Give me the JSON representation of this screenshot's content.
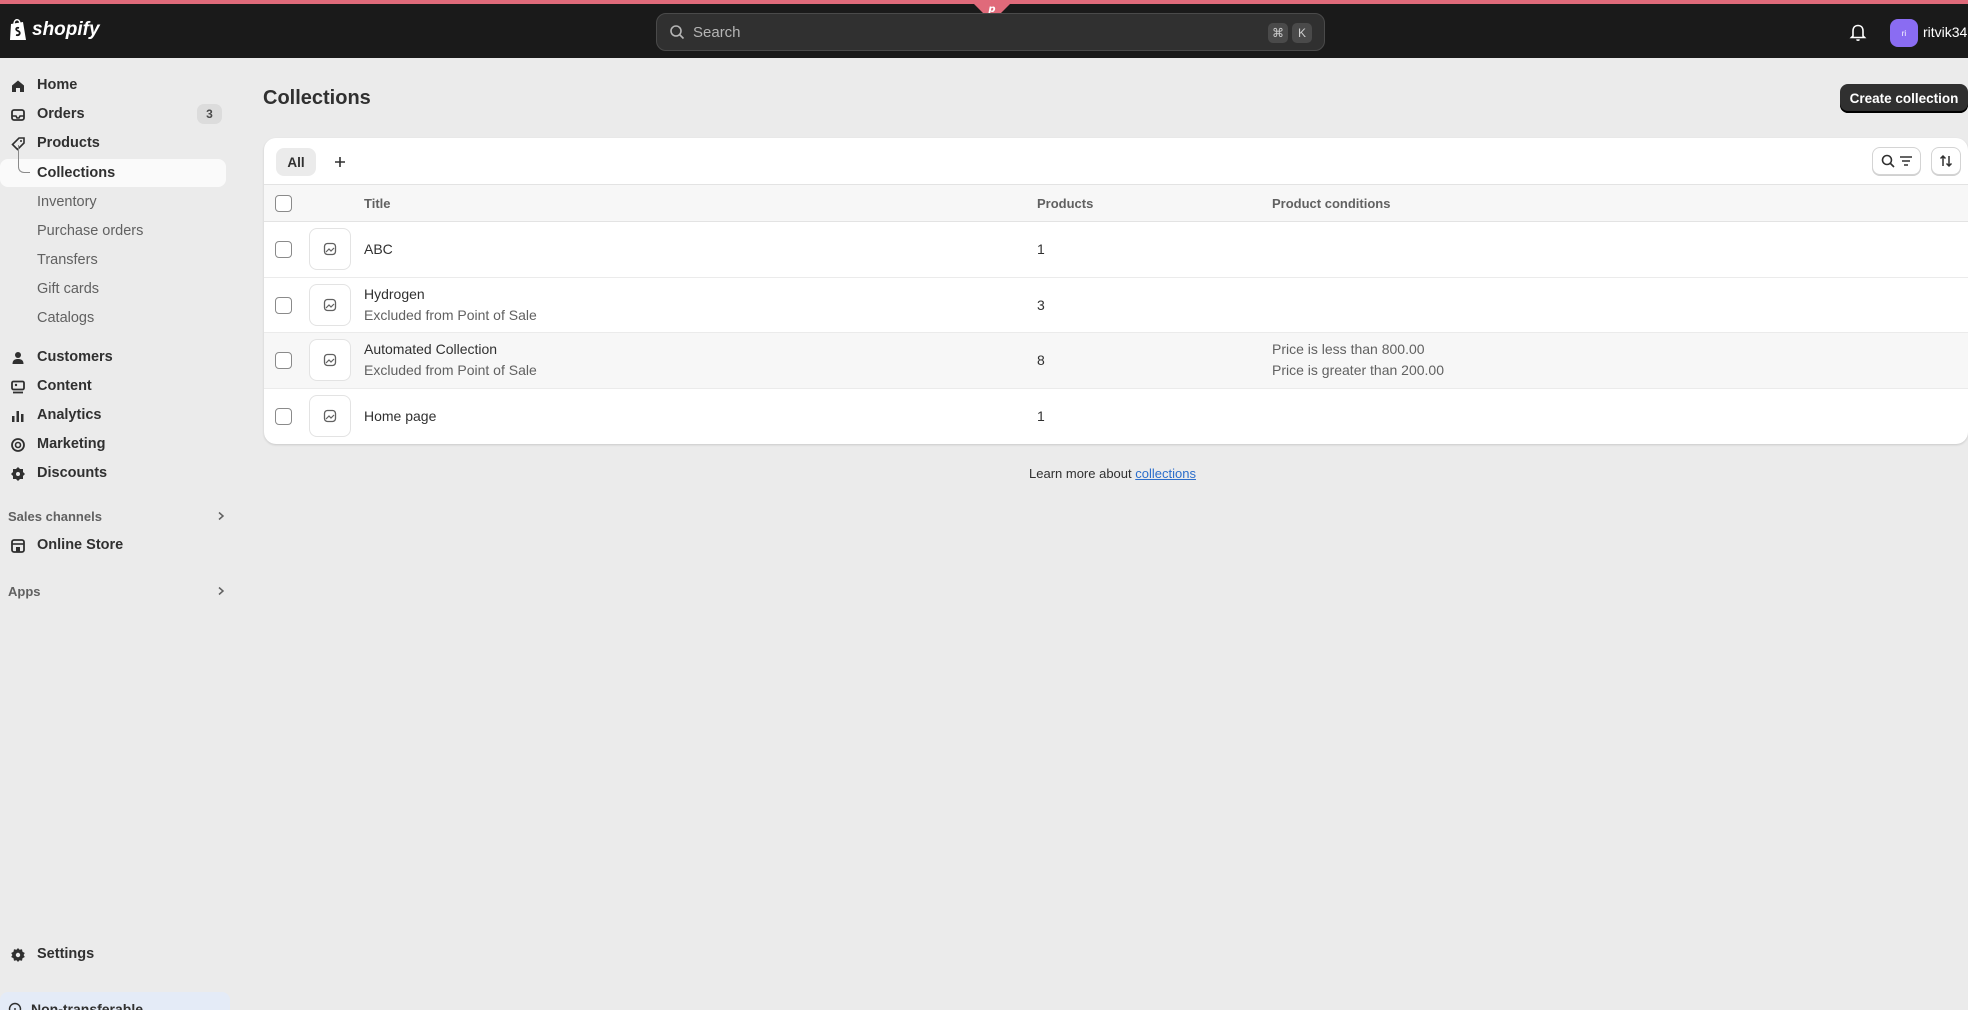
{
  "topbar": {
    "logo_text": "shopify",
    "search_placeholder": "Search",
    "shortcut_keys": [
      "⌘",
      "K"
    ],
    "username": "ritvik34",
    "avatar_initials": "ri",
    "accent_color": "#e06a7a"
  },
  "sidebar": {
    "items": [
      {
        "label": "Home",
        "icon": "home-icon"
      },
      {
        "label": "Orders",
        "icon": "orders-icon",
        "badge": "3"
      },
      {
        "label": "Products",
        "icon": "tag-icon"
      },
      {
        "label": "Collections",
        "active": true
      },
      {
        "label": "Inventory"
      },
      {
        "label": "Purchase orders"
      },
      {
        "label": "Transfers"
      },
      {
        "label": "Gift cards"
      },
      {
        "label": "Catalogs"
      },
      {
        "label": "Customers",
        "icon": "person-icon"
      },
      {
        "label": "Content",
        "icon": "content-icon"
      },
      {
        "label": "Analytics",
        "icon": "analytics-icon"
      },
      {
        "label": "Marketing",
        "icon": "target-icon"
      },
      {
        "label": "Discounts",
        "icon": "discount-icon"
      }
    ],
    "sales_channels_label": "Sales channels",
    "online_store_label": "Online Store",
    "apps_label": "Apps",
    "settings_label": "Settings",
    "bottom_label": "Non-transferable"
  },
  "main": {
    "title": "Collections",
    "create_button": "Create collection",
    "tabs": [
      {
        "label": "All",
        "selected": true
      }
    ],
    "columns": [
      "Title",
      "Products",
      "Product conditions"
    ],
    "rows": [
      {
        "title": "ABC",
        "subtitle": "",
        "products": "1",
        "conditions": []
      },
      {
        "title": "Hydrogen",
        "subtitle": "Excluded from Point of Sale",
        "products": "3",
        "conditions": []
      },
      {
        "title": "Automated Collection",
        "subtitle": "Excluded from Point of Sale",
        "products": "8",
        "conditions": [
          "Price is less than 800.00",
          "Price is greater than 200.00"
        ]
      },
      {
        "title": "Home page",
        "subtitle": "",
        "products": "1",
        "conditions": []
      }
    ],
    "learn_prefix": "Learn more about",
    "learn_link": "collections"
  }
}
